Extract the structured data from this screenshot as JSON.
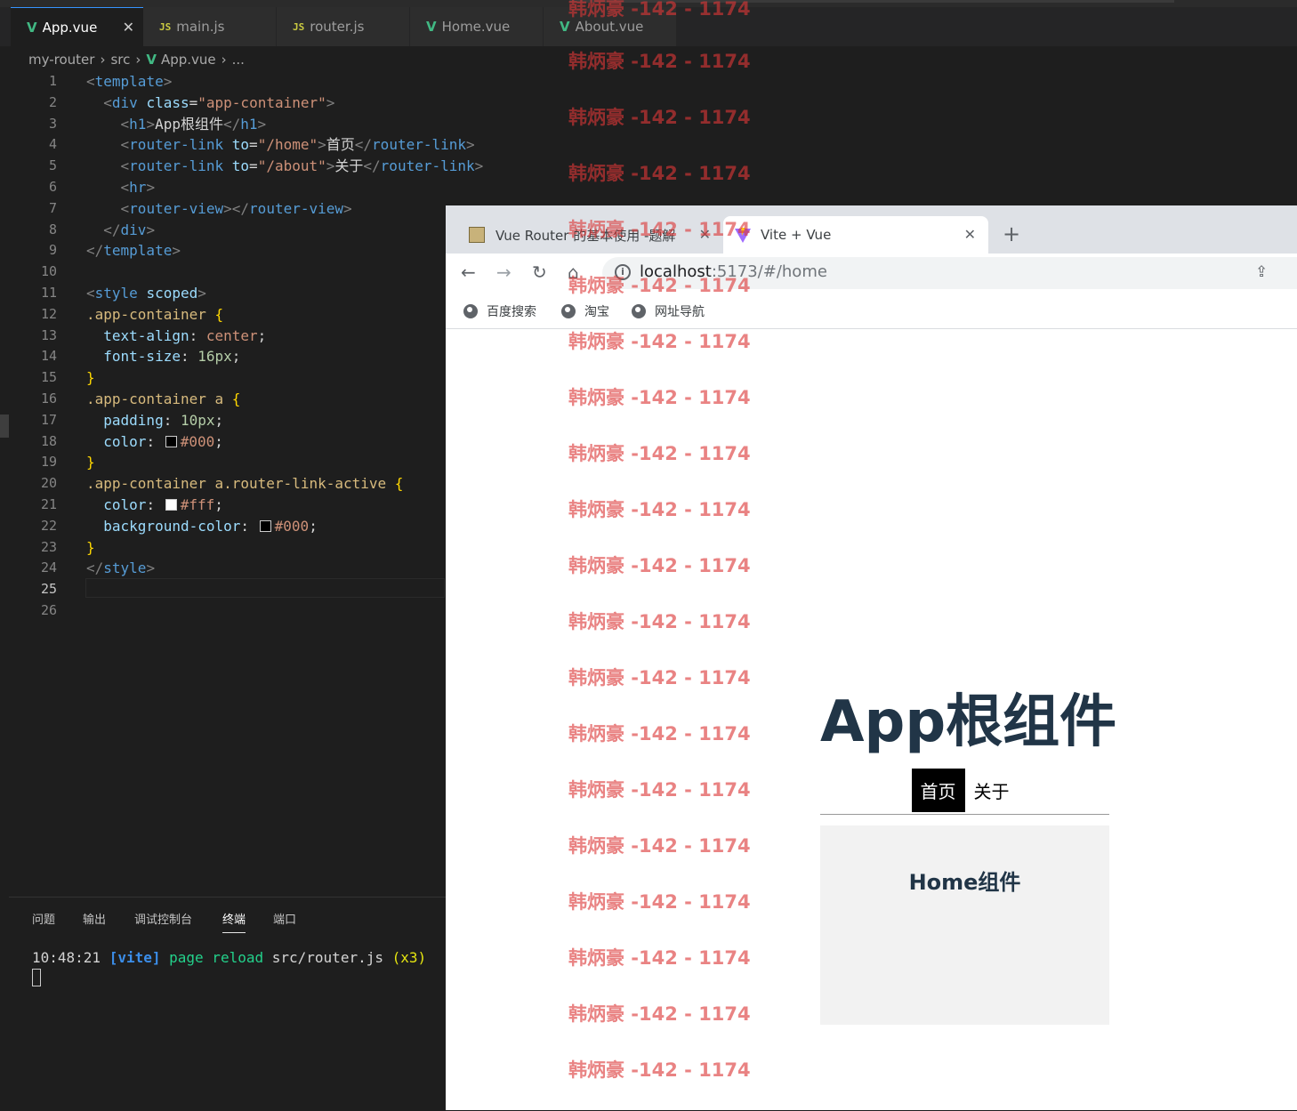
{
  "editor": {
    "tabs": [
      {
        "label": "App.vue",
        "icon": "vue-icon"
      },
      {
        "label": "main.js",
        "icon": "js-icon"
      },
      {
        "label": "router.js",
        "icon": "js-icon"
      },
      {
        "label": "Home.vue",
        "icon": "vue-icon"
      },
      {
        "label": "About.vue",
        "icon": "vue-icon"
      }
    ],
    "breadcrumb": [
      "my-router",
      "src",
      "App.vue",
      "..."
    ],
    "line_numbers": [
      "1",
      "2",
      "3",
      "4",
      "5",
      "6",
      "7",
      "8",
      "9",
      "10",
      "11",
      "12",
      "13",
      "14",
      "15",
      "16",
      "17",
      "18",
      "19",
      "20",
      "21",
      "22",
      "23",
      "24",
      "25",
      "26"
    ],
    "current_line": "25",
    "code": {
      "l1_tag": "template",
      "l2_tag": "div",
      "l2_attr": "class",
      "l2_val": "\"app-container\"",
      "l3_tag": "h1",
      "l3_text": "App根组件",
      "l4_tag": "router-link",
      "l4_attr": "to",
      "l4_val": "\"/home\"",
      "l4_text": "首页",
      "l5_tag": "router-link",
      "l5_attr": "to",
      "l5_val": "\"/about\"",
      "l5_text": "关于",
      "l6_tag": "hr",
      "l7_tag": "router-view",
      "l8_tag": "div",
      "l9_tag": "template",
      "l11_tag": "style",
      "l11_attr": "scoped",
      "l12_sel": ".app-container",
      "l13_prop": "text-align",
      "l13_val": "center",
      "l14_prop": "font-size",
      "l14_val": "16px",
      "l16_sel": ".app-container a",
      "l17_prop": "padding",
      "l17_val": "10px",
      "l18_prop": "color",
      "l18_val": "#000",
      "l20_sel": ".app-container a.router-link-active",
      "l21_prop": "color",
      "l21_val": "#fff",
      "l22_prop": "background-color",
      "l22_val": "#000",
      "l24_tag": "style"
    },
    "swatches": {
      "black": "#000000",
      "white": "#ffffff"
    }
  },
  "panel": {
    "tabs": [
      "问题",
      "输出",
      "调试控制台",
      "终端",
      "端口"
    ],
    "active_tab": "终端",
    "terminal": {
      "time": "10:48:21",
      "tag": "[vite]",
      "msg": "page reload",
      "file": "src/router.js",
      "count": "(x3)"
    }
  },
  "browser": {
    "tabs": [
      {
        "label": "Vue Router 的基本使用 -题解"
      },
      {
        "label": "Vite + Vue"
      }
    ],
    "url_host": "localhost",
    "url_rest": ":5173/#/home",
    "bookmarks": [
      "百度搜索",
      "淘宝",
      "网址导航"
    ],
    "page": {
      "title": "App根组件",
      "links": [
        "首页",
        "关于"
      ],
      "home_title": "Home组件"
    }
  },
  "watermark": "韩炳豪 -142 - 1174",
  "colors": {
    "vue_green": "#41b883",
    "js_yellow": "#cbcb41",
    "page_text": "#213547",
    "watermark": "#dc3737"
  }
}
